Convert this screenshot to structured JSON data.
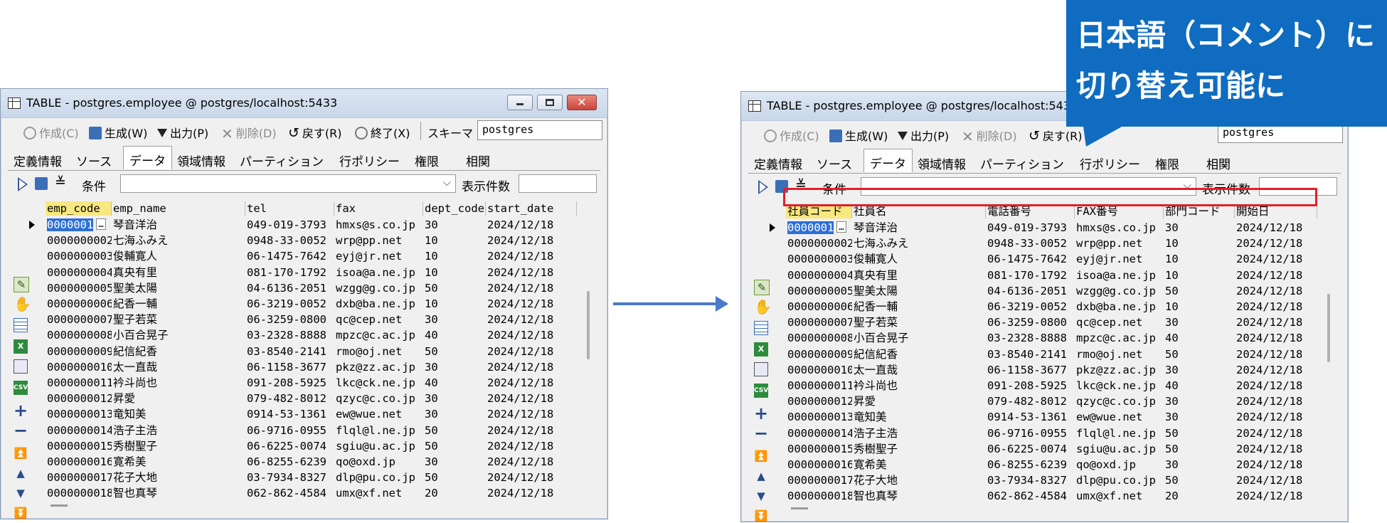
{
  "left": {
    "title": "TABLE - postgres.employee @ postgres/localhost:5433",
    "headers": [
      "emp_code",
      "emp_name",
      "tel",
      "fax",
      "dept_code",
      "start_date"
    ]
  },
  "right": {
    "title": "TABLE - postgres.employee @ postgres/localhost:5433",
    "headers": [
      "社員コード",
      "社員名",
      "電話番号",
      "FAX番号",
      "部門コード",
      "開始日"
    ]
  },
  "toolbar": {
    "create": "作成(C)",
    "generate": "生成(W)",
    "output": "出力(P)",
    "delete": "削除(D)",
    "undo": "戻す(R)",
    "close": "終了(X)",
    "schema_label": "スキーマ",
    "schema_value": "postgres"
  },
  "tabs": [
    "定義情報",
    "ソース",
    "データ",
    "領域情報",
    "パーティション",
    "行ポリシー",
    "権限",
    "相関"
  ],
  "filter": {
    "condition_label": "条件",
    "count_label": "表示件数"
  },
  "callout": {
    "line1": "日本語（コメント）に",
    "line2": "切り替え可能に"
  },
  "dots_label": "…",
  "rows": [
    [
      "0000001",
      "琴音洋治",
      "049-019-3793",
      "hmxs@s.co.jp",
      "30",
      "2024/12/18"
    ],
    [
      "0000000002",
      "七海ふみえ",
      "0948-33-0052",
      "wrp@pp.net",
      "10",
      "2024/12/18"
    ],
    [
      "0000000003",
      "俊輔寛人",
      "06-1475-7642",
      "eyj@jr.net",
      "10",
      "2024/12/18"
    ],
    [
      "0000000004",
      "真央有里",
      "081-170-1792",
      "isoa@a.ne.jp",
      "10",
      "2024/12/18"
    ],
    [
      "0000000005",
      "聖美太陽",
      "04-6136-2051",
      "wzgg@g.co.jp",
      "50",
      "2024/12/18"
    ],
    [
      "0000000006",
      "紀香一輔",
      "06-3219-0052",
      "dxb@ba.ne.jp",
      "10",
      "2024/12/18"
    ],
    [
      "0000000007",
      "聖子若菜",
      "06-3259-0800",
      "qc@cep.net",
      "30",
      "2024/12/18"
    ],
    [
      "0000000008",
      "小百合晃子",
      "03-2328-8888",
      "mpzc@c.ac.jp",
      "40",
      "2024/12/18"
    ],
    [
      "0000000009",
      "紀信紀香",
      "03-8540-2141",
      "rmo@oj.net",
      "50",
      "2024/12/18"
    ],
    [
      "0000000010",
      "太一直哉",
      "06-1158-3677",
      "pkz@zz.ac.jp",
      "30",
      "2024/12/18"
    ],
    [
      "0000000011",
      "衿斗尚也",
      "091-208-5925",
      "lkc@ck.ne.jp",
      "40",
      "2024/12/18"
    ],
    [
      "0000000012",
      "昇愛",
      "079-482-8012",
      "qzyc@c.co.jp",
      "30",
      "2024/12/18"
    ],
    [
      "0000000013",
      "竜知美",
      "0914-53-1361",
      "ew@wue.net",
      "30",
      "2024/12/18"
    ],
    [
      "0000000014",
      "浩子主浩",
      "06-9716-0955",
      "flql@l.ne.jp",
      "50",
      "2024/12/18"
    ],
    [
      "0000000015",
      "秀樹聖子",
      "06-6225-0074",
      "sgiu@u.ac.jp",
      "50",
      "2024/12/18"
    ],
    [
      "0000000016",
      "寛希美",
      "06-8255-6239",
      "qo@oxd.jp",
      "30",
      "2024/12/18"
    ],
    [
      "0000000017",
      "花子大地",
      "03-7934-8327",
      "dlp@pu.co.jp",
      "50",
      "2024/12/18"
    ],
    [
      "0000000018",
      "智也真琴",
      "062-862-4584",
      "umx@xf.net",
      "20",
      "2024/12/18"
    ]
  ]
}
